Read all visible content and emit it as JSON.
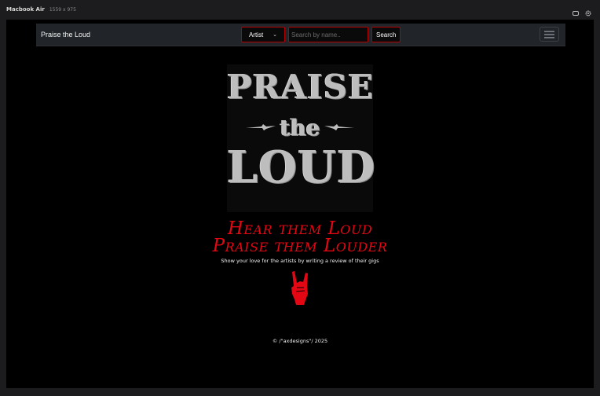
{
  "device": {
    "name": "Macbook Air",
    "size": "1559 x 975",
    "icons": [
      "rotate-icon",
      "settings-icon"
    ]
  },
  "navbar": {
    "brand": "Praise the Loud",
    "search_category": "Artist",
    "search_placeholder": "Search by name..",
    "search_button": "Search",
    "menu_icon": "hamburger-icon"
  },
  "hero": {
    "logo_lines": [
      "PRAISE",
      "the",
      "LOUD"
    ],
    "tagline_line1": "Hear them Loud",
    "tagline_line2": "Praise them Louder",
    "subtitle": "Show your love for the artists by writing a review of their gigs",
    "icon": "rock-horns-hand-icon"
  },
  "footer": {
    "copyright": "© /\"axdesigns\"/ 2025"
  },
  "colors": {
    "accent_red": "#e30613",
    "navbar_bg": "#212529",
    "page_bg": "#000000"
  }
}
